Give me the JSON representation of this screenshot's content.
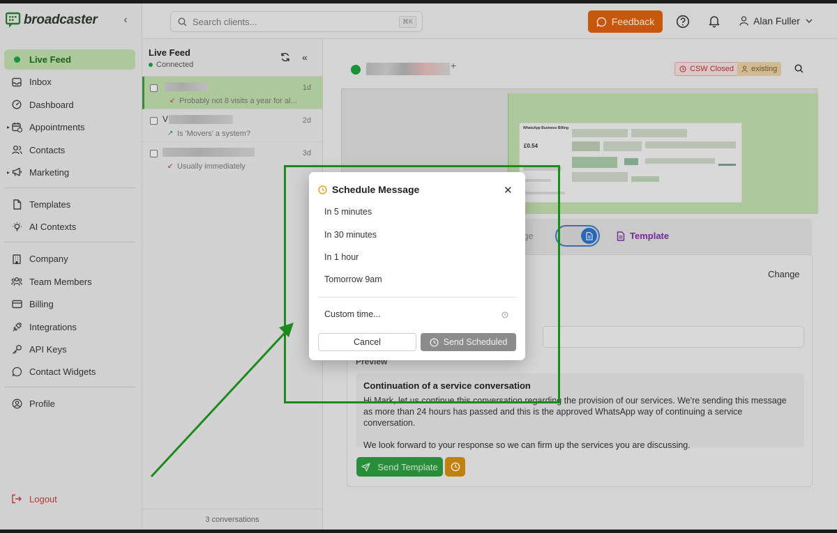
{
  "brand": {
    "name": "broadcaster"
  },
  "sidebar": {
    "items": [
      {
        "label": "Live Feed",
        "icon": "dot-icon",
        "active": true
      },
      {
        "label": "Inbox",
        "icon": "inbox-icon"
      },
      {
        "label": "Dashboard",
        "icon": "gauge-icon"
      },
      {
        "label": "Appointments",
        "icon": "calendar-icon",
        "expandable": true
      },
      {
        "label": "Contacts",
        "icon": "users-icon"
      },
      {
        "label": "Marketing",
        "icon": "megaphone-icon",
        "expandable": true
      },
      {
        "label": "Templates",
        "icon": "file-icon"
      },
      {
        "label": "AI Contexts",
        "icon": "lightbulb-icon"
      },
      {
        "label": "Company",
        "icon": "building-icon"
      },
      {
        "label": "Team Members",
        "icon": "team-icon"
      },
      {
        "label": "Billing",
        "icon": "card-icon"
      },
      {
        "label": "Integrations",
        "icon": "plug-icon"
      },
      {
        "label": "API Keys",
        "icon": "key-icon"
      },
      {
        "label": "Contact Widgets",
        "icon": "chat-icon"
      },
      {
        "label": "Profile",
        "icon": "profile-icon"
      }
    ],
    "logout": "Logout"
  },
  "header": {
    "search_placeholder": "Search clients...",
    "shortcut": "⌘K",
    "feedback": "Feedback",
    "user_name": "Alan Fuller"
  },
  "convlist": {
    "title": "Live Feed",
    "status": "Connected",
    "conversations": [
      {
        "name": "",
        "time": "1d",
        "preview": "Probably not 8 visits a year for al...",
        "direction": "in",
        "selected": true
      },
      {
        "name": "V",
        "time": "2d",
        "preview": "Is 'Movers' a system?",
        "direction": "out"
      },
      {
        "name": "",
        "time": "3d",
        "preview": "Usually immediately",
        "direction": "in"
      }
    ],
    "footer": "3 conversations"
  },
  "main": {
    "badges": {
      "csw": "CSW Closed",
      "existing": "existing"
    },
    "attachment": {
      "title": "WhatsApp Business Billing",
      "price": "£0.54"
    },
    "composer": {
      "left_tab": "age",
      "template_tab": "Template"
    },
    "editor": {
      "change": "Change",
      "preview_label": "Preview",
      "preview_title": "Continuation of a service conversation",
      "preview_body": "Hi Mark, let us continue this conversation regarding the provision of our services. We're sending this message as more than 24 hours has passed and this is the approved WhatsApp way of continuing a service conversation.\n\nWe look forward to your response so we can firm up the services you are discussing.",
      "send_template": "Send Template"
    }
  },
  "modal": {
    "title": "Schedule Message",
    "options": [
      "In 5 minutes",
      "In 30 minutes",
      "In 1 hour",
      "Tomorrow 9am"
    ],
    "custom": "Custom time...",
    "cancel": "Cancel",
    "send_scheduled": "Send Scheduled"
  },
  "colors": {
    "accent_green": "#2d9b3f",
    "feedback_orange": "#d7600f",
    "schedule_amber": "#d38b10",
    "annotation_green": "#1c8a1c"
  }
}
